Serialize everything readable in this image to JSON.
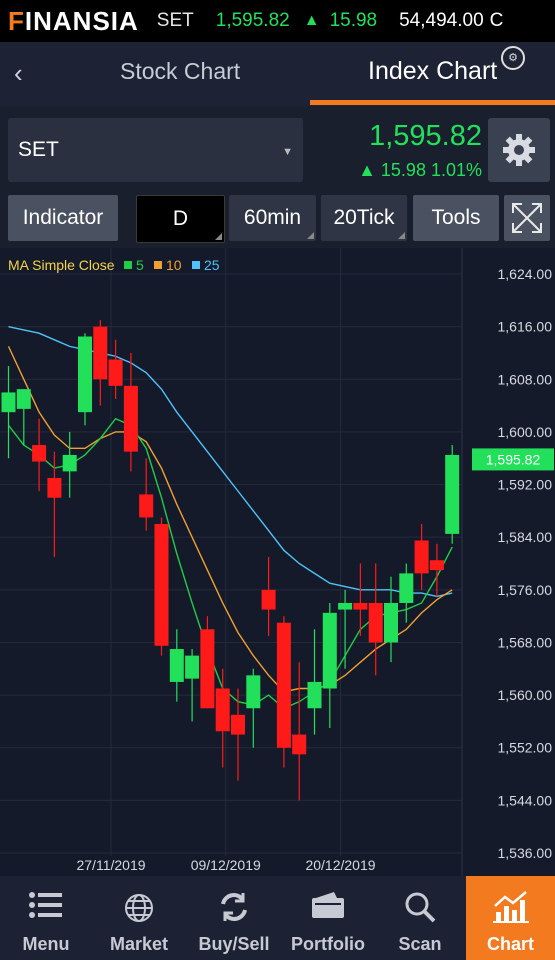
{
  "ticker": {
    "logo": "INANSIA",
    "logo_prefix": "F",
    "symbol": "SET",
    "price": "1,595.82",
    "change": "15.98",
    "volume": "54,494.00",
    "more": "C"
  },
  "tabs": {
    "stock": "Stock Chart",
    "index": "Index Chart"
  },
  "symbol_select": {
    "value": "SET",
    "price": "1,595.82",
    "change": "▲ 15.98  1.01%"
  },
  "toolbar": {
    "indicator": "Indicator",
    "d": "D",
    "min60": "60min",
    "tick20": "20Tick",
    "tools": "Tools"
  },
  "legend": {
    "label": "MA Simple Close",
    "ma5": "5",
    "ma10": "10",
    "ma25": "25",
    "colors": {
      "ma5": "#22cc44",
      "ma10": "#f0a030",
      "ma25": "#4fc3f7"
    }
  },
  "chart_data": {
    "type": "candlestick",
    "y_ticks": [
      "1,624.00",
      "1,616.00",
      "1,608.00",
      "1,600.00",
      "1,592.00",
      "1,584.00",
      "1,576.00",
      "1,568.00",
      "1,560.00",
      "1,552.00",
      "1,544.00",
      "1,536.00"
    ],
    "y_range": [
      1536,
      1624
    ],
    "x_labels": [
      {
        "label": "27/11/2019",
        "index": 6.7
      },
      {
        "label": "09/12/2019",
        "index": 14.2
      },
      {
        "label": "20/12/2019",
        "index": 21.7
      }
    ],
    "last_price_label": "1,595.82",
    "last_price": 1595.82,
    "candles": [
      {
        "o": 1603,
        "h": 1610,
        "l": 1596,
        "c": 1606
      },
      {
        "o": 1603.5,
        "h": 1606,
        "l": 1598,
        "c": 1606.5
      },
      {
        "o": 1598,
        "h": 1602,
        "l": 1591,
        "c": 1595.5
      },
      {
        "o": 1593,
        "h": 1597,
        "l": 1581,
        "c": 1590
      },
      {
        "o": 1594,
        "h": 1600,
        "l": 1590,
        "c": 1596.5
      },
      {
        "o": 1603,
        "h": 1615,
        "l": 1601,
        "c": 1614.5
      },
      {
        "o": 1616,
        "h": 1617,
        "l": 1604,
        "c": 1608
      },
      {
        "o": 1611,
        "h": 1614,
        "l": 1605,
        "c": 1607
      },
      {
        "o": 1607,
        "h": 1612,
        "l": 1594,
        "c": 1597
      },
      {
        "o": 1590.5,
        "h": 1596,
        "l": 1585,
        "c": 1587
      },
      {
        "o": 1586,
        "h": 1587,
        "l": 1566,
        "c": 1567.5
      },
      {
        "o": 1562,
        "h": 1570,
        "l": 1559,
        "c": 1567
      },
      {
        "o": 1562.5,
        "h": 1567,
        "l": 1556,
        "c": 1566
      },
      {
        "o": 1570,
        "h": 1572,
        "l": 1558,
        "c": 1558
      },
      {
        "o": 1561,
        "h": 1564,
        "l": 1549,
        "c": 1554.5
      },
      {
        "o": 1557,
        "h": 1561,
        "l": 1547,
        "c": 1554
      },
      {
        "o": 1558,
        "h": 1564,
        "l": 1552,
        "c": 1563
      },
      {
        "o": 1576,
        "h": 1581,
        "l": 1569,
        "c": 1573
      },
      {
        "o": 1571,
        "h": 1572,
        "l": 1549,
        "c": 1552
      },
      {
        "o": 1554,
        "h": 1565,
        "l": 1544,
        "c": 1551
      },
      {
        "o": 1558,
        "h": 1570,
        "l": 1554,
        "c": 1562
      },
      {
        "o": 1561,
        "h": 1574,
        "l": 1555,
        "c": 1572.5
      },
      {
        "o": 1573,
        "h": 1576,
        "l": 1564,
        "c": 1574
      },
      {
        "o": 1574,
        "h": 1580,
        "l": 1569,
        "c": 1573
      },
      {
        "o": 1574,
        "h": 1580,
        "l": 1563,
        "c": 1568
      },
      {
        "o": 1568,
        "h": 1578,
        "l": 1565,
        "c": 1574
      },
      {
        "o": 1574,
        "h": 1580,
        "l": 1571,
        "c": 1578.5
      },
      {
        "o": 1583.5,
        "h": 1586,
        "l": 1576,
        "c": 1578.5
      },
      {
        "o": 1580.5,
        "h": 1583,
        "l": 1575,
        "c": 1579
      },
      {
        "o": 1584.5,
        "h": 1598,
        "l": 1583,
        "c": 1596.5
      }
    ],
    "ma5": [
      1601,
      1598,
      1596.5,
      1594.5,
      1595,
      1596.5,
      1599,
      1602,
      1601,
      1597.5,
      1590,
      1581.5,
      1574,
      1567,
      1561,
      1559,
      1558.5,
      1560,
      1558,
      1559,
      1560.5,
      1562,
      1566,
      1570,
      1572,
      1572.5,
      1573,
      1574,
      1578,
      1582.5
    ],
    "ma10": [
      1613,
      1608,
      1603,
      1599.5,
      1597.5,
      1597.5,
      1599,
      1600,
      1600,
      1598.5,
      1594.5,
      1589,
      1584,
      1579,
      1574,
      1569.5,
      1566,
      1563,
      1560.5,
      1561,
      1561,
      1561.5,
      1563,
      1565,
      1567,
      1568.5,
      1570,
      1572.5,
      1574.5,
      1576
    ],
    "ma25": [
      1616,
      1615.5,
      1615,
      1614,
      1613,
      1612.5,
      1612,
      1611.5,
      1610.5,
      1609,
      1606.5,
      1603,
      1600,
      1597,
      1594,
      1591,
      1588,
      1585,
      1582,
      1580,
      1578.5,
      1577,
      1576.5,
      1576,
      1576,
      1576,
      1575.5,
      1575.5,
      1575,
      1575.5
    ]
  },
  "nav": {
    "items": [
      {
        "label": "Menu",
        "icon": "menu-icon"
      },
      {
        "label": "Market",
        "icon": "globe-icon"
      },
      {
        "label": "Buy/Sell",
        "icon": "buy-sell-icon"
      },
      {
        "label": "Portfolio",
        "icon": "wallet-icon"
      },
      {
        "label": "Scan",
        "icon": "search-icon"
      },
      {
        "label": "Chart",
        "icon": "chart-icon"
      }
    ]
  },
  "colors": {
    "accent": "#f47a20",
    "up": "#22e05a",
    "down": "#ff1a1a"
  }
}
